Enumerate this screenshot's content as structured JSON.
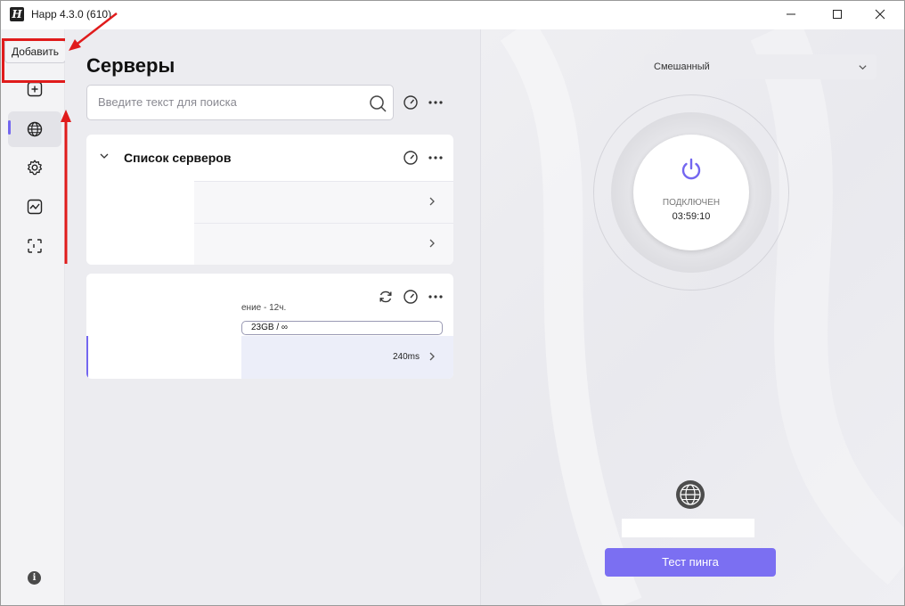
{
  "window": {
    "title": "Happ 4.3.0 (610)",
    "logo_glyph": "H"
  },
  "rail": {
    "tooltip": "Добавить",
    "items": [
      {
        "name": "add",
        "icon": "plus-square-icon"
      },
      {
        "name": "servers",
        "icon": "globe-icon",
        "active": true
      },
      {
        "name": "settings",
        "icon": "gear-icon"
      },
      {
        "name": "stats",
        "icon": "chart-icon"
      },
      {
        "name": "routing",
        "icon": "scan-icon"
      }
    ],
    "info_glyph": "i"
  },
  "servers": {
    "title": "Серверы",
    "search_placeholder": "Введите текст для поиска",
    "group1": {
      "title": "Список серверов"
    },
    "group2": {
      "subscription_note": "ение - 12ч.",
      "traffic": "23GB / ∞",
      "selected_ping": "240ms"
    }
  },
  "connection": {
    "mode": "Смешанный",
    "status": "ПОДКЛЮЧЕН",
    "time": "03:59:10",
    "ping_test_button": "Тест пинга"
  },
  "colors": {
    "accent": "#7366f0",
    "button": "#7b6ff2",
    "annotation": "#e01b1b"
  }
}
